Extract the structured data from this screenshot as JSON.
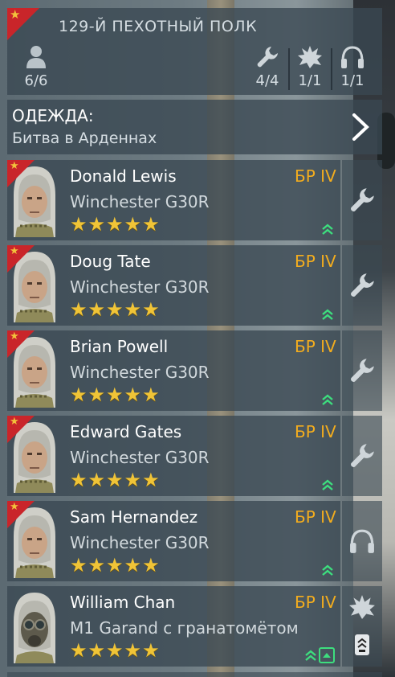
{
  "header": {
    "regiment_name": "129-Й ПЕХОТНЫЙ ПОЛК",
    "flag_color": "#c9252a",
    "squad_size": "6/6",
    "engineers": "4/4",
    "anti_tank": "1/1",
    "radio": "1/1",
    "icons": [
      "person-icon",
      "wrench-icon",
      "explosion-icon",
      "headphones-icon"
    ]
  },
  "outfit": {
    "title": "ОДЕЖДА:",
    "value": "Битва в Арденнах"
  },
  "soldiers": [
    {
      "name": "Donald Lewis",
      "weapon": "Winchester G30R",
      "br": "БР IV",
      "stars": 5,
      "role_icon": "wrench-icon",
      "flag": true
    },
    {
      "name": "Doug Tate",
      "weapon": "Winchester G30R",
      "br": "БР IV",
      "stars": 5,
      "role_icon": "wrench-icon",
      "flag": true
    },
    {
      "name": "Brian Powell",
      "weapon": "Winchester G30R",
      "br": "БР IV",
      "stars": 5,
      "role_icon": "wrench-icon",
      "flag": true
    },
    {
      "name": "Edward Gates",
      "weapon": "Winchester G30R",
      "br": "БР IV",
      "stars": 5,
      "role_icon": "wrench-icon",
      "flag": true
    },
    {
      "name": "Sam Hernandez",
      "weapon": "Winchester G30R",
      "br": "БР IV",
      "stars": 5,
      "role_icon": "headphones-icon",
      "flag": true
    },
    {
      "name": "William Chan",
      "weapon": "M1 Garand с гранатомётом",
      "br": "БР IV",
      "stars": 5,
      "role_icon": "explosion-icon",
      "flag": false
    }
  ],
  "colors": {
    "br_text": "#f3ad1e",
    "star": "#f0c437",
    "upgrade_arrow": "#3dde7e"
  }
}
